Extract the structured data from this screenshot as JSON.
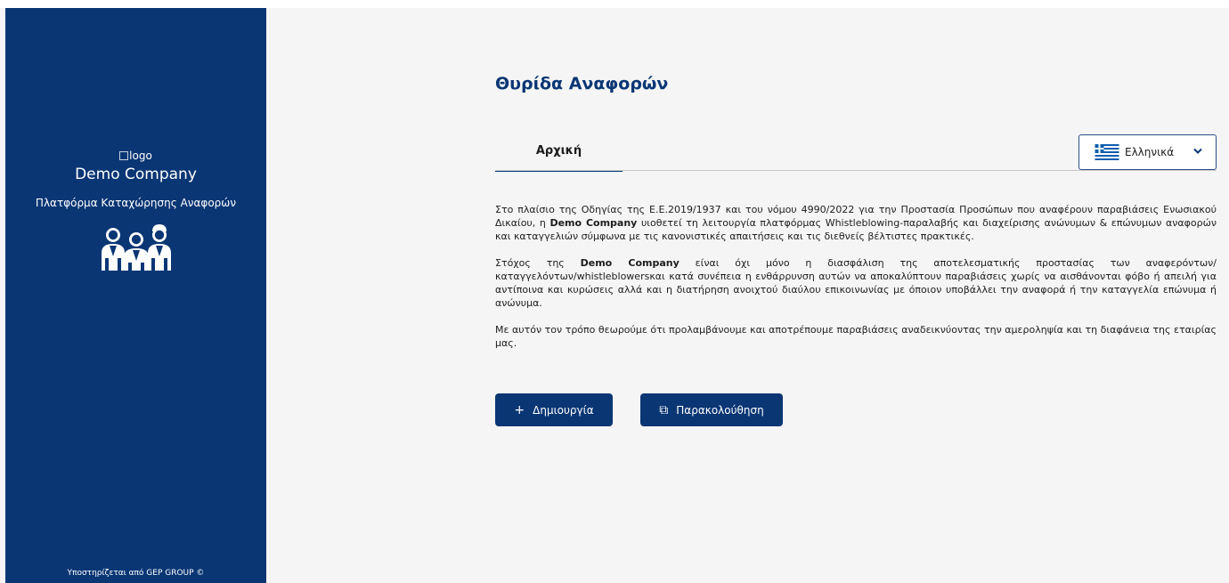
{
  "sidebar": {
    "logo_alt": "logo",
    "company_name": "Demo Company",
    "platform_name": "Πλατφόρμα Καταχώρησης Αναφορών",
    "people_icon": "whistleblowers-group-icon",
    "powered_by": "Υποστηρίζεται από GEP GROUP ©"
  },
  "main": {
    "title": "Θυρίδα Αναφορών",
    "tabs": [
      {
        "label": "Αρχική",
        "active": true
      }
    ],
    "language": {
      "selected": "Ελληνικά",
      "flag_icon": "greece-flag-icon",
      "chevron_icon": "chevron-down-icon"
    },
    "paragraphs": [
      {
        "pre": "Στο πλαίσιο της Οδηγίας της Ε.Ε.2019/1937 και του νόμου 4990/2022 για την Προστασία Προσώπων που αναφέρουν παραβιάσεις Ενωσιακού Δικαίου, η ",
        "bold": "Demo Company",
        "post": " υιοθετεί τη λειτουργία πλατφόρμας Whistleblowing-παραλαβής και διαχείρισης ανώνυμων & επώνυμων αναφορών και καταγγελιών σύμφωνα με τις κανονιστικές απαιτήσεις και τις διεθνείς βέλτιστες πρακτικές."
      },
      {
        "pre": "Στόχος της ",
        "bold": "Demo Company",
        "post": " είναι όχι μόνο η διασφάλιση της αποτελεσματικής προστασίας των αναφερόντων/ καταγγελόντων/whistleblowersκαι κατά συνέπεια η ενθάρρυνση αυτών να αποκαλύπτουν παραβιάσεις χωρίς να αισθάνονται φόβο ή απειλή για αντίποινα και κυρώσεις αλλά και η διατήρηση ανοιχτού διαύλου επικοινωνίας με όποιον υποβάλλει την αναφορά ή την καταγγελία επώνυμα ή ανώνυμα."
      },
      {
        "pre": "Με αυτόν τον τρόπο θεωρούμε ότι προλαμβάνουμε και αποτρέπουμε παραβιάσεις αναδεικνύοντας την αμεροληψία και τη διαφάνεια της εταιρίας μας.",
        "bold": "",
        "post": ""
      }
    ],
    "buttons": {
      "create": {
        "icon": "+",
        "icon_name": "plus-icon",
        "label": "Δημιουργία"
      },
      "track": {
        "icon": "⧉",
        "icon_name": "external-link-icon",
        "label": "Παρακολούθηση"
      }
    }
  },
  "colors": {
    "primary": "#0a3674",
    "background": "#f5f5f5",
    "text": "#1d1d1d"
  }
}
